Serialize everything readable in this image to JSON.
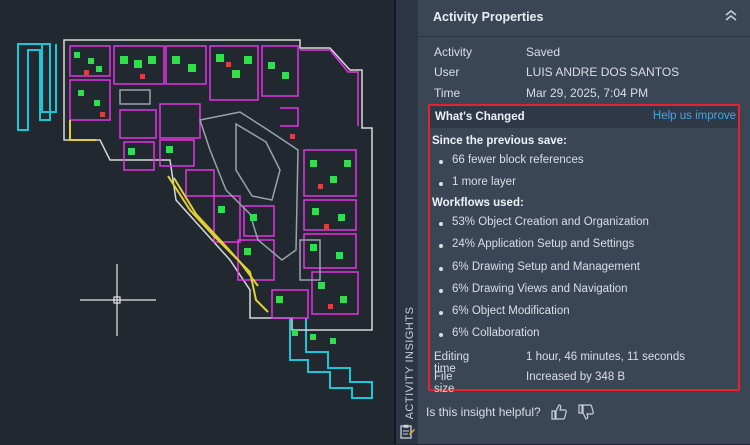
{
  "side_tab": {
    "label": "ACTIVITY INSIGHTS",
    "icon": "clipboard-icon"
  },
  "panel": {
    "title": "Activity Properties",
    "collapse_icon": "chevron-double-up-icon",
    "properties": [
      {
        "key": "Activity",
        "value": "Saved"
      },
      {
        "key": "User",
        "value": "LUIS ANDRE DOS SANTOS"
      },
      {
        "key": "Time",
        "value": "Mar 29, 2025, 7:04 PM"
      }
    ],
    "whats_changed": {
      "title": "What's Changed",
      "help_link": "Help us improve",
      "since_heading": "Since the previous save:",
      "since_items": [
        "66 fewer block references",
        "1 more layer"
      ],
      "workflows_heading": "Workflows used:",
      "workflows": [
        "53% Object Creation and Organization",
        "24% Application Setup and Settings",
        "6% Drawing Setup and Management",
        "6% Drawing Views and Navigation",
        "6% Object Modification",
        "6% Collaboration"
      ],
      "editing_time": {
        "key": "Editing time",
        "value": "1 hour, 46 minutes, 11 seconds"
      },
      "file_size": {
        "key": "File size",
        "value": "Increased by 348 B"
      }
    },
    "feedback": {
      "question": "Is this insight helpful?",
      "up_icon": "thumbs-up-icon",
      "down_icon": "thumbs-down-icon"
    }
  },
  "colors": {
    "canvas_bg": "#212830",
    "panel_bg": "#3a4556",
    "highlight_border": "#e8212b",
    "link": "#45a6e6"
  }
}
